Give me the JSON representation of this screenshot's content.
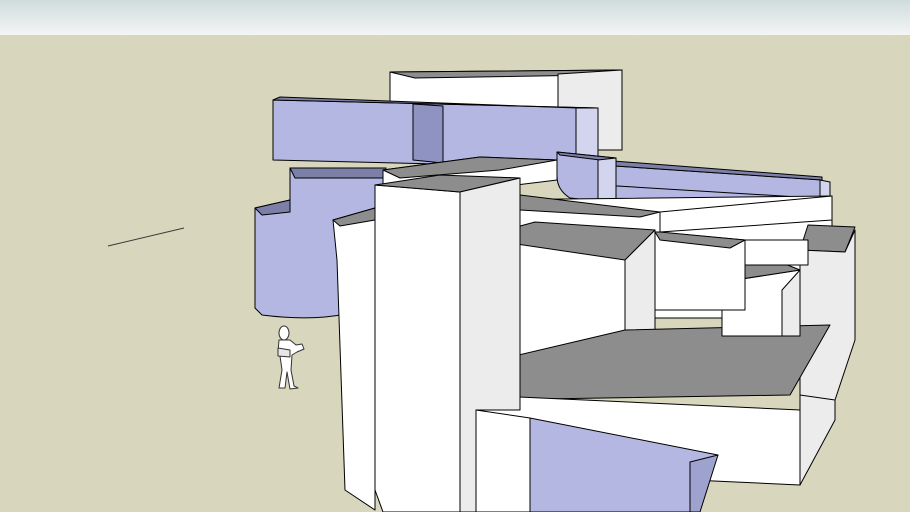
{
  "viewport": {
    "sky_top_color": "#cfdcdc",
    "sky_bottom_color": "#f2f5f4",
    "ground_color": "#d8d6bc"
  },
  "model": {
    "lit_face_color": "#ffffff",
    "roof_color": "#8d8d8d",
    "tinted_face_color": "#b3b7e1",
    "tinted_shadow_color": "#7c80a8",
    "edge_color": "#000000"
  },
  "figure": {
    "icon": "standing-person-scale-figure"
  }
}
